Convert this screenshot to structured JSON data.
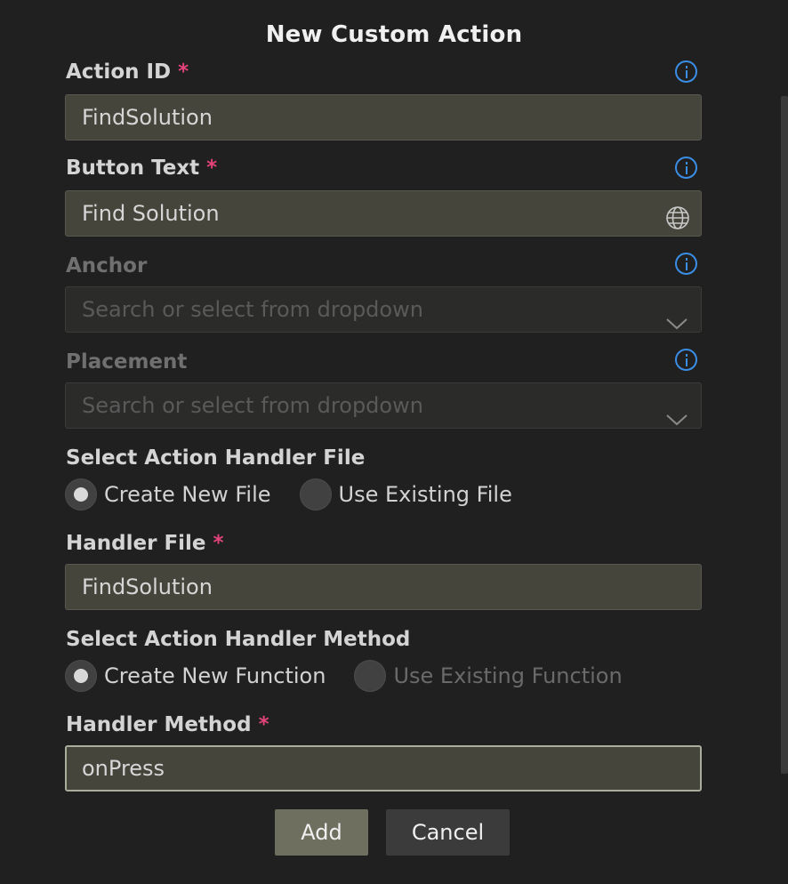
{
  "dialog": {
    "title": "New Custom Action"
  },
  "fields": {
    "action_id": {
      "label": "Action ID",
      "required": "*",
      "value": "FindSolution"
    },
    "button_text": {
      "label": "Button Text",
      "required": "*",
      "value": "Find Solution"
    },
    "anchor": {
      "label": "Anchor",
      "placeholder": "Search or select from dropdown"
    },
    "placement": {
      "label": "Placement",
      "placeholder": "Search or select from dropdown"
    },
    "handler_file": {
      "label": "Handler File",
      "required": "*",
      "value": "FindSolution"
    },
    "handler_method": {
      "label": "Handler Method",
      "required": "*",
      "value": "onPress"
    }
  },
  "handler_file_selection": {
    "label": "Select Action Handler File",
    "options": [
      "Create New File",
      "Use Existing File"
    ],
    "selected": "Create New File"
  },
  "handler_method_selection": {
    "label": "Select Action Handler Method",
    "options": [
      "Create New Function",
      "Use Existing Function"
    ],
    "selected": "Create New Function"
  },
  "buttons": {
    "add": "Add",
    "cancel": "Cancel"
  },
  "icons": {
    "info": "info-icon",
    "globe": "globe-icon",
    "dropdown": "chevron-down-icon"
  },
  "colors": {
    "accent_info": "#3a8ee6",
    "required": "#e2437a",
    "primary_button": "#6f6f5f"
  }
}
